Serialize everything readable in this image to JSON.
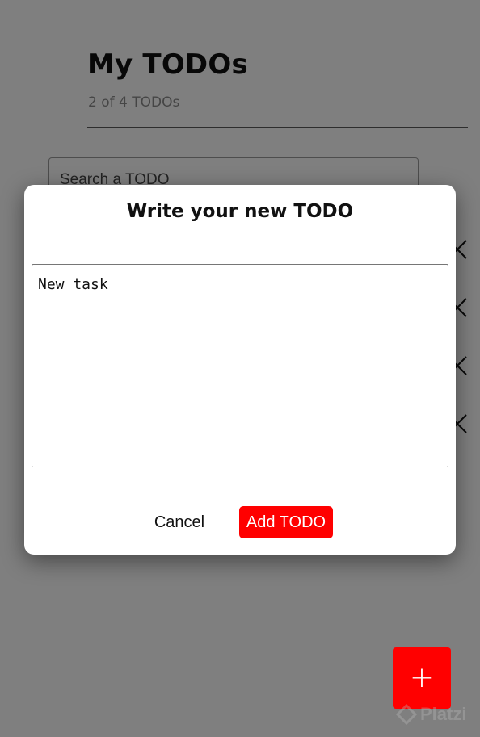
{
  "header": {
    "title": "My TODOs",
    "counter": "2 of 4 TODOs"
  },
  "search": {
    "placeholder": "Search a TODO"
  },
  "todo_items": [
    {
      "close_icon": "close-icon"
    },
    {
      "close_icon": "close-icon"
    },
    {
      "close_icon": "close-icon"
    },
    {
      "close_icon": "close-icon"
    }
  ],
  "modal": {
    "title": "Write your new TODO",
    "textarea_value": "New task",
    "cancel_label": "Cancel",
    "add_label": "Add TODO"
  },
  "fab": {
    "label": "+"
  },
  "watermark": {
    "text": "Platzi"
  },
  "colors": {
    "accent": "#ff0000",
    "overlay": "#000000",
    "text": "#111111",
    "muted": "#8a8a8a"
  }
}
